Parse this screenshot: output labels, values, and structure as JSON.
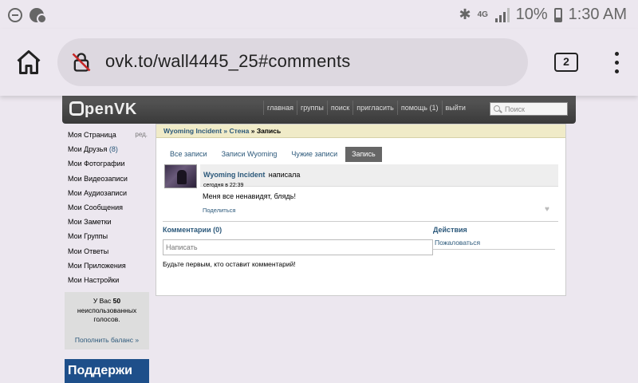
{
  "status_bar": {
    "network": "4G",
    "battery": "10%",
    "time": "1:30 AM"
  },
  "browser": {
    "url": "ovk.to/wall4445_25#comments",
    "tab_count": "2"
  },
  "site": {
    "logo": "penVK",
    "nav": [
      "главная",
      "группы",
      "поиск",
      "пригласить",
      "помощь (1)",
      "выйти"
    ],
    "search_placeholder": "Поиск"
  },
  "sidebar": {
    "my_page": "Моя Страница",
    "edit": "ред.",
    "friends": "Мои Друзья",
    "friends_count": "(8)",
    "photos": "Мои Фотографии",
    "videos": "Мои Видеозаписи",
    "audios": "Мои Аудиозаписи",
    "messages": "Мои Сообщения",
    "notes": "Мои Заметки",
    "groups": "Мои Группы",
    "answers": "Мои Ответы",
    "apps": "Мои Приложения",
    "settings": "Мои Настройки",
    "votes_prefix": "У Вас",
    "votes_count": "50",
    "votes_suffix": "неиспользованных голосов.",
    "top_up": "Пополнить баланс »",
    "support": "Поддержи"
  },
  "breadcrumb": {
    "owner": "Wyoming Incident",
    "sep1": " » ",
    "wall": "Стена",
    "sep2": " » ",
    "current": "Запись"
  },
  "tabs": [
    "Все записи",
    "Записи Wyoming",
    "Чужие записи",
    "Запись"
  ],
  "post": {
    "author": "Wyoming Incident",
    "action": "написала",
    "time": "сегодня в 22:39",
    "text": "Меня все ненавидят, блядь!",
    "share": "Поделиться"
  },
  "comments": {
    "title": "Комментарии (0)",
    "placeholder": "Написать",
    "empty": "Будьте первым, кто оставит комментарий!"
  },
  "actions": {
    "title": "Действия",
    "report": "Пожаловаться"
  }
}
